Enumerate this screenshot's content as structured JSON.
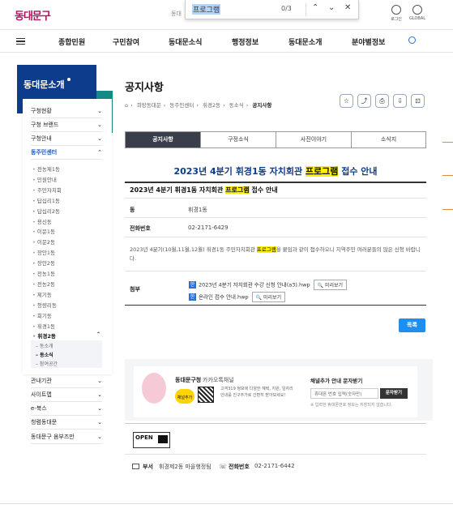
{
  "header": {
    "logo": "동대문구",
    "nav_fragment": "동대",
    "utils": [
      {
        "label": "로그인",
        "icon": "user-icon"
      },
      {
        "label": "GLOBAL",
        "icon": "globe-icon"
      }
    ]
  },
  "findbar": {
    "query": "프로그램",
    "count": "0/3",
    "prev": "⌃",
    "next": "⌄",
    "close": "✕"
  },
  "gnb": {
    "items": [
      "종합민원",
      "구민참여",
      "동대문소식",
      "행정정보",
      "동대문소개",
      "분야별정보"
    ]
  },
  "sidebar": {
    "title": "동대문소개",
    "menu_top": [
      {
        "label": "구청현황",
        "chevron": "⌄"
      },
      {
        "label": "구청 브랜드",
        "chevron": "⌄"
      },
      {
        "label": "구청안내",
        "chevron": "⌄"
      },
      {
        "label": "동주민센터",
        "chevron": "⌃"
      }
    ],
    "dongs": [
      "전농제1동",
      "민원안내",
      "주민자치회",
      "답십리1동",
      "답십리2동",
      "용신동",
      "이문1동",
      "이문2동",
      "장안1동",
      "장안2동",
      "전농1동",
      "전농2동",
      "제기동",
      "청량리동",
      "회기동",
      "휘경1동",
      "휘경2동"
    ],
    "dong_chevron": "⌃",
    "sub3": [
      "동소개",
      "동소식",
      "참여공간"
    ],
    "menu_bottom": [
      {
        "label": "관내기관",
        "chevron": "⌄"
      },
      {
        "label": "사이트맵",
        "chevron": "⌄"
      },
      {
        "label": "e-북스",
        "chevron": "⌄"
      },
      {
        "label": "청렴동대문",
        "chevron": "⌄"
      },
      {
        "label": "동대문구 옴부즈만",
        "chevron": "⌄"
      }
    ]
  },
  "content": {
    "page_title": "공지사항",
    "breadcrumb": [
      "⌂",
      "희망동대문",
      "동주민센터",
      "휘경2동",
      "동소식",
      "공지사항"
    ],
    "tools": [
      "☆",
      "⤴",
      "⎙",
      "⇩",
      "⊡"
    ],
    "tabs": [
      "공지사항",
      "구정소식",
      "사진이야기",
      "소식지"
    ],
    "post_title_pre": "2023년 4분기 휘경1동 자치회관 ",
    "post_title_hl": "프로그램",
    "post_title_post": " 접수 안내",
    "row_title_pre": "2023년 4분기 휘경1동 자치회관 ",
    "row_title_hl": "프로그램",
    "row_title_post": " 접수 안내",
    "fields": [
      {
        "label": "동",
        "value": "휘경1동"
      },
      {
        "label": "전화번호",
        "value": "02-2171-6429"
      }
    ],
    "body_pre": "2023년 4분기(10월,11월,12월) 휘경1동 주민자치회관 ",
    "body_hl": "프로그램",
    "body_post": "을 붙임과 같이 접수하오니 지역주민 여러분들의 많은 신청 바랍니다.",
    "attach_label": "첨부",
    "attachments": [
      {
        "icon": "한",
        "name": "2023년 4분기 자치회관 수강 신청 안내(a3).hwp",
        "preview": "🔍 미리보기"
      },
      {
        "icon": "한",
        "name": "온라인 접수 안내.hwp",
        "preview": "🔍 미리보기"
      }
    ],
    "list_button": "목록"
  },
  "footer": {
    "kakao_title": "동대문구청",
    "kakao_sub": "카카오톡채널",
    "kakao_bubble": "채널추가",
    "kakao_desc": "고객319 정보에 다양한 혜택, 지원, 일자리 안내를 친구추가로 간편히 받아보세요!",
    "sms_title": "채널추가 안내 문자받기",
    "sms_placeholder": "휴대폰 번호 입력(숫자만)",
    "sms_button": "문자받기",
    "sms_note": "※ 입력한 휴대폰번호 정보는 저장되지 않습니다.",
    "kogl": "OPEN",
    "dept_label": "부서",
    "dept_value": "휘경제2동 마을행정팀",
    "tel_label": "전화번호",
    "tel_value": "02-2171-6442"
  }
}
